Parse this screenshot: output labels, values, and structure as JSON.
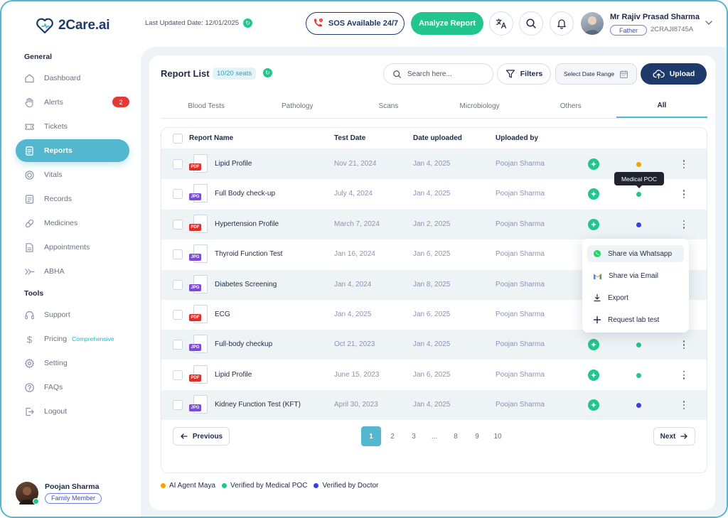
{
  "app": {
    "name": "2Care.ai"
  },
  "header": {
    "last_updated": "Last Updated Date: 12/01/2025",
    "sos_label": "SOS Available 24/7",
    "analyze_label": "Analyze Report",
    "user_name": "Mr Rajiv Prasad Sharma",
    "relation": "Father",
    "user_id": "2CRAJI8745A"
  },
  "sidebar": {
    "general_title": "General",
    "tools_title": "Tools",
    "items": [
      {
        "label": "Dashboard",
        "icon": "home-icon"
      },
      {
        "label": "Alerts",
        "icon": "hand-icon",
        "badge": "2"
      },
      {
        "label": "Tickets",
        "icon": "ticket-icon"
      },
      {
        "label": "Reports",
        "icon": "document-icon",
        "active": true
      },
      {
        "label": "Vitals",
        "icon": "target-icon"
      },
      {
        "label": "Records",
        "icon": "records-icon"
      },
      {
        "label": "Medicines",
        "icon": "pill-icon"
      },
      {
        "label": "Appointments",
        "icon": "file-icon"
      },
      {
        "label": "ABHA",
        "icon": "arrow-icon"
      }
    ],
    "tools": [
      {
        "label": "Support",
        "icon": "headset-icon"
      },
      {
        "label": "Pricing",
        "icon": "dollar-icon",
        "sub": "Comprehensive"
      },
      {
        "label": "Setting",
        "icon": "gear-icon"
      },
      {
        "label": "FAQs",
        "icon": "question-icon"
      },
      {
        "label": "Logout",
        "icon": "logout-icon"
      }
    ],
    "member_name": "Poojan Sharma",
    "member_role": "Family Member"
  },
  "toolbar": {
    "title": "Report List",
    "seats": "10/20 seats",
    "search_placeholder": "Search here...",
    "filters_label": "Filters",
    "date_range_label": "Select Date Range",
    "upload_label": "Upload"
  },
  "tabs": [
    "Blood Tests",
    "Pathology",
    "Scans",
    "Microbiology",
    "Others",
    "All"
  ],
  "active_tab": "All",
  "table": {
    "headers": [
      "Report Name",
      "Test Date",
      "Date uploaded",
      "Uploaded by"
    ],
    "rows": [
      {
        "type": "PDF",
        "name": "Lipid Profile",
        "test_date": "Nov 21, 2024",
        "uploaded": "Jan 4, 2025",
        "by": "Poojan Sharma",
        "status": "ai"
      },
      {
        "type": "JPG",
        "name": "Full Body check-up",
        "test_date": "July 4, 2024",
        "uploaded": "Jan 4, 2025",
        "by": "Poojan Sharma",
        "status": "poc"
      },
      {
        "type": "PDF",
        "name": "Hypertension Profile",
        "test_date": "March 7, 2024",
        "uploaded": "Jan 2, 2025",
        "by": "Poojan Sharma",
        "status": "doctor"
      },
      {
        "type": "JPG",
        "name": "Thyroid Function Test",
        "test_date": "Jan 16, 2024",
        "uploaded": "Jan 6, 2025",
        "by": "Poojan Sharma",
        "status": "hidden"
      },
      {
        "type": "JPG",
        "name": "Diabetes Screening",
        "test_date": "Jan 4, 2024",
        "uploaded": "Jan 8, 2025",
        "by": "Poojan Sharma",
        "status": "hidden"
      },
      {
        "type": "PDF",
        "name": "ECG",
        "test_date": "Jan 4, 2025",
        "uploaded": "Jan 6, 2025",
        "by": "Poojan Sharma",
        "status": "hidden"
      },
      {
        "type": "JPG",
        "name": "Full-body checkup",
        "test_date": "Oct 21, 2023",
        "uploaded": "Jan 4, 2025",
        "by": "Poojan Sharma",
        "status": "poc"
      },
      {
        "type": "PDF",
        "name": "Lipid Profile",
        "test_date": "June 15, 2023",
        "uploaded": "Jan 6, 2025",
        "by": "Poojan Sharma",
        "status": "poc"
      },
      {
        "type": "JPG",
        "name": "Kidney Function Test (KFT)",
        "test_date": "April 30, 2023",
        "uploaded": "Jan 4, 2025",
        "by": "Poojan Sharma",
        "status": "doctor"
      }
    ]
  },
  "pagination": {
    "previous": "Previous",
    "next": "Next",
    "pages": [
      "1",
      "2",
      "3",
      "...",
      "8",
      "9",
      "10"
    ],
    "current": "1"
  },
  "legend": [
    {
      "label": "AI Agent Maya",
      "color": "#f0a500"
    },
    {
      "label": "Verified by Medical POC",
      "color": "#22c58b"
    },
    {
      "label": "Verified by Doctor",
      "color": "#3b3ee0"
    }
  ],
  "tooltip": "Medical POC",
  "context_menu": [
    {
      "label": "Share via Whatsapp",
      "icon": "whatsapp-icon"
    },
    {
      "label": "Share via Email",
      "icon": "gmail-icon"
    },
    {
      "label": "Export",
      "icon": "download-icon"
    },
    {
      "label": "Request lab test",
      "icon": "plus-icon"
    }
  ],
  "colors": {
    "accent": "#52b7cf",
    "primary": "#1d3a6b",
    "success": "#22c58b",
    "danger": "#e53935"
  }
}
